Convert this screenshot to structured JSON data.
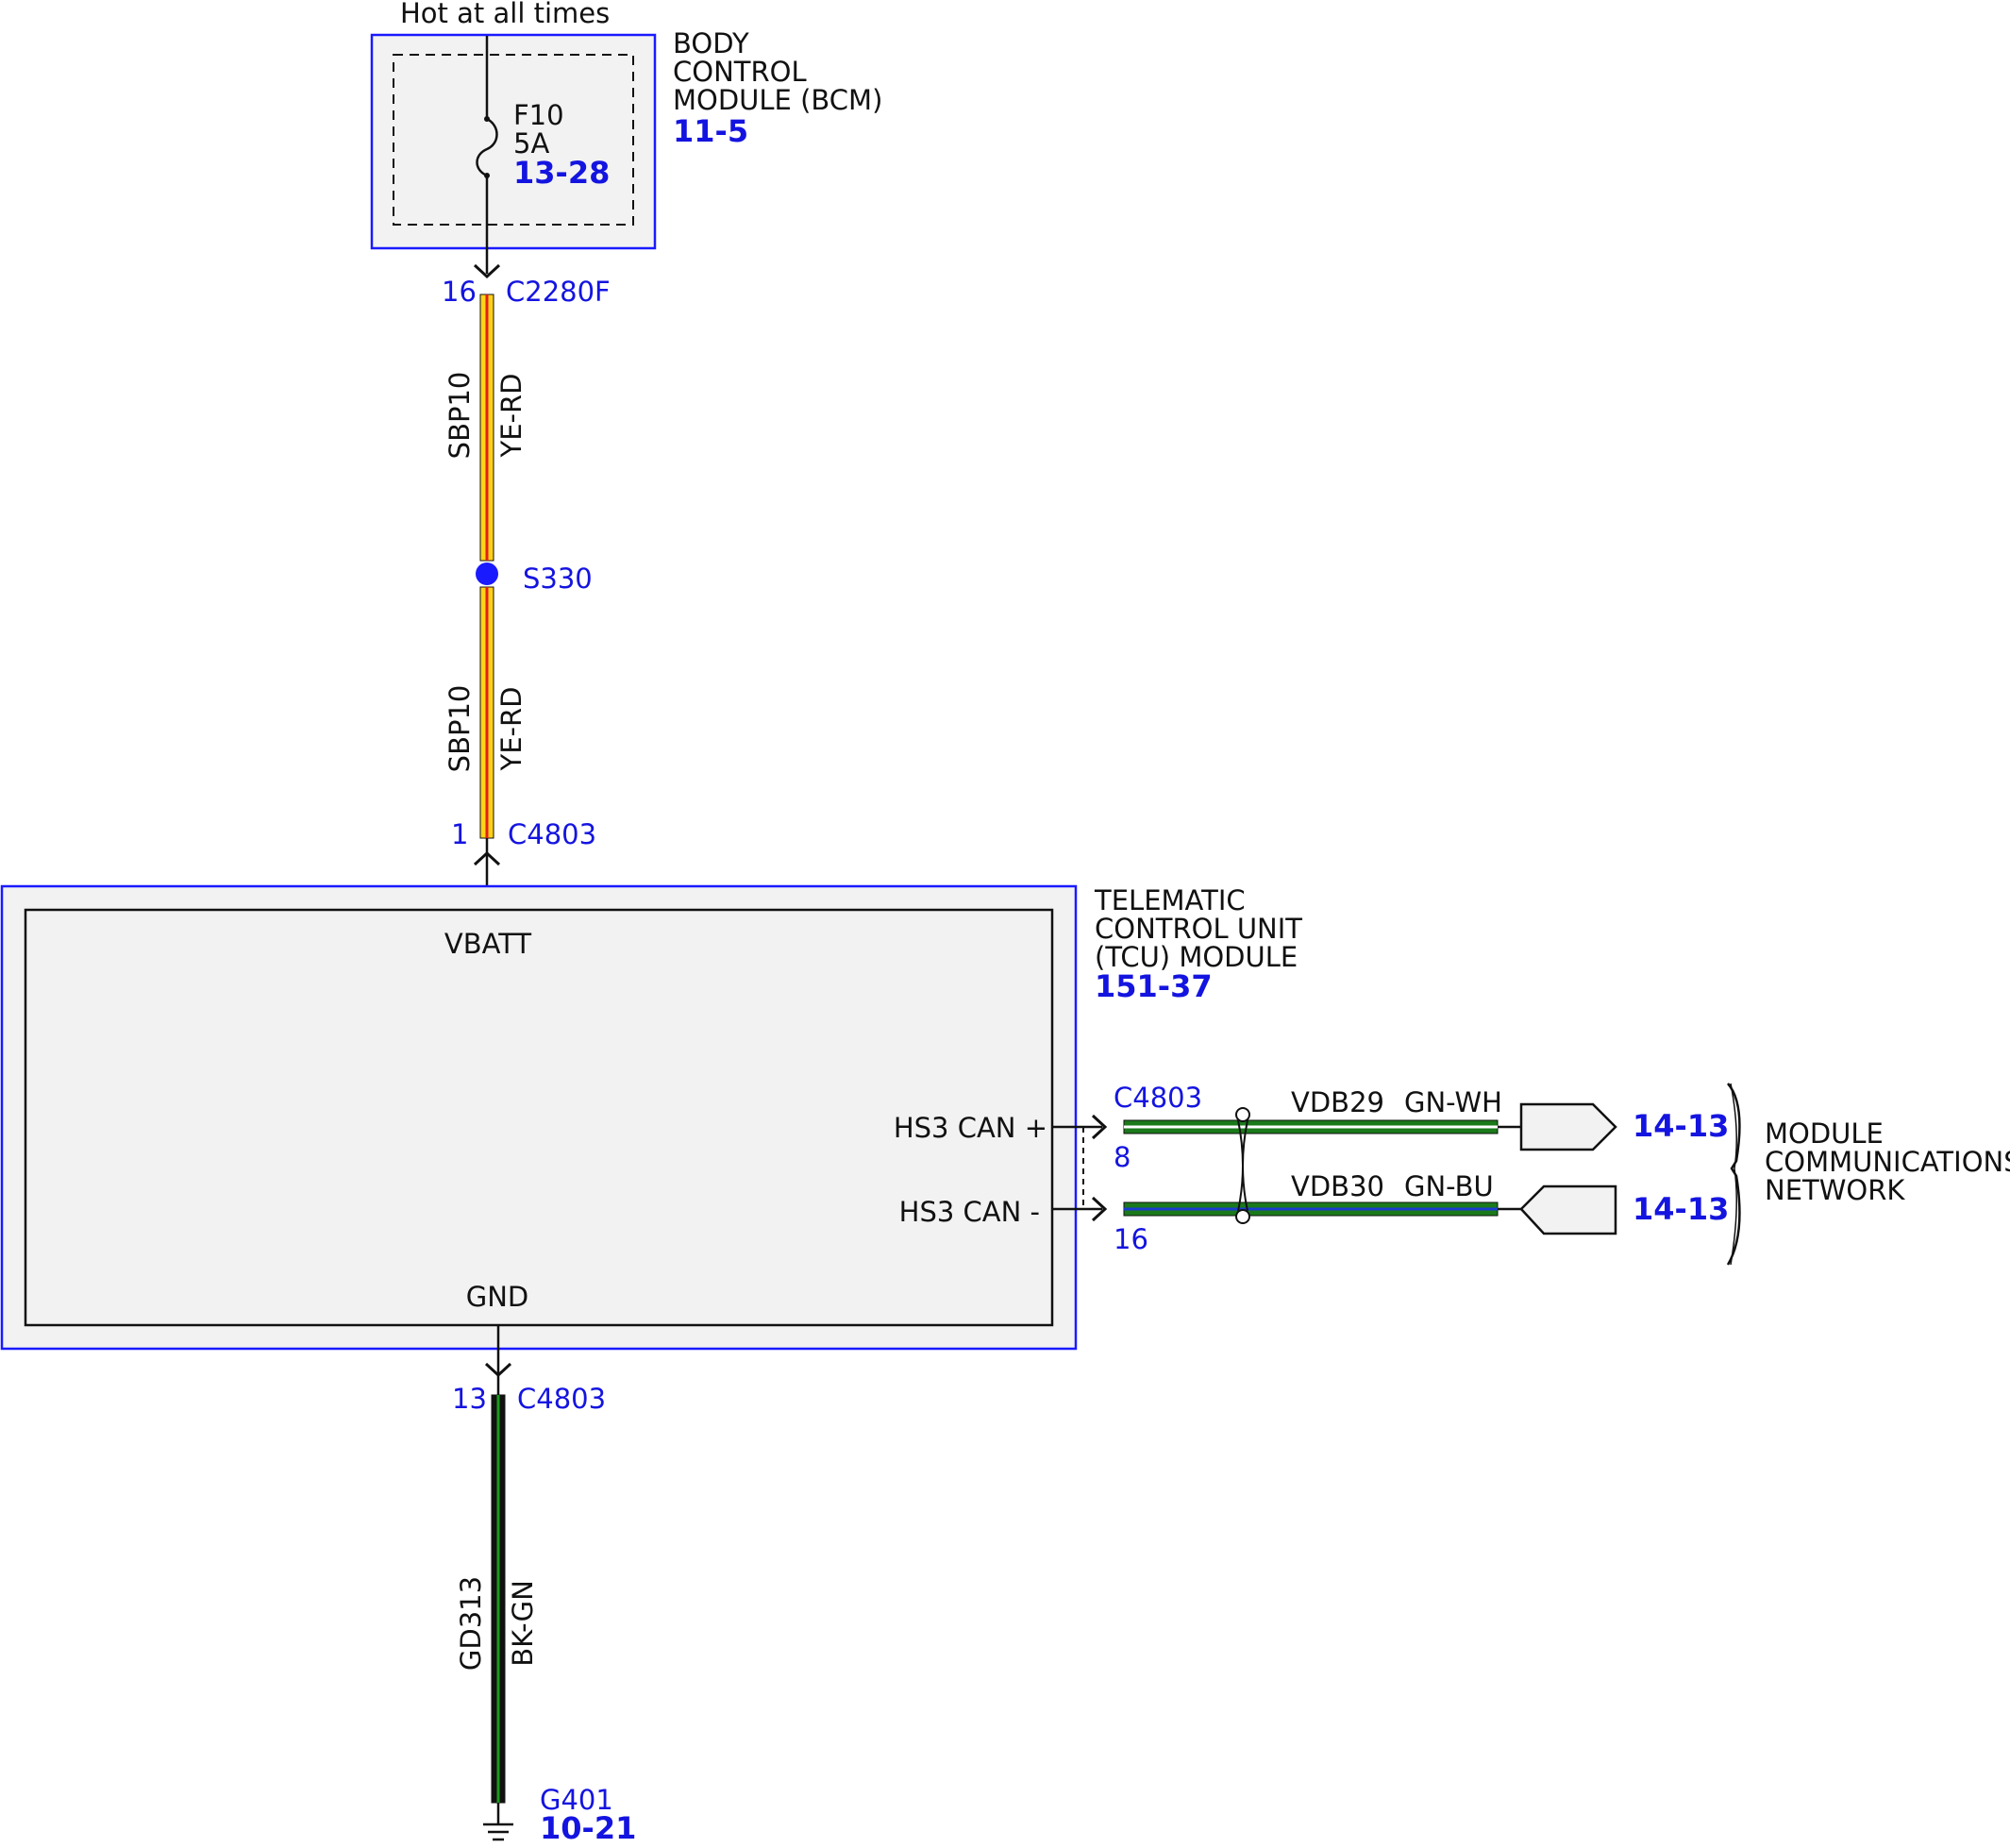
{
  "colors": {
    "module_border": "#1a1aff",
    "module_fill": "#f2f2f2",
    "label_blue": "#1414e0",
    "wire_yellow": "#ffd21a",
    "wire_red": "#e0201a",
    "wire_green": "#1a7a1a",
    "wire_white": "#ffffff",
    "wire_blue": "#1a3ad0",
    "wire_black": "#111111"
  },
  "power_label": "Hot at all times",
  "bcm": {
    "name_lines": [
      "BODY",
      "CONTROL",
      "MODULE (BCM)"
    ],
    "ref": "11-5",
    "fuse": {
      "name": "F10",
      "rating": "5A",
      "ref": "13-28"
    }
  },
  "connector_bcm": {
    "pin": "16",
    "id": "C2280F"
  },
  "wire_sbp10_upper": {
    "circuit": "SBP10",
    "color_code": "YE-RD"
  },
  "splice": {
    "id": "S330"
  },
  "wire_sbp10_lower": {
    "circuit": "SBP10",
    "color_code": "YE-RD"
  },
  "connector_tcu_power": {
    "pin": "1",
    "id": "C4803"
  },
  "tcu": {
    "name_lines": [
      "TELEMATIC",
      "CONTROL UNIT",
      "(TCU) MODULE"
    ],
    "ref": "151-37",
    "pin_vbatt": "VBATT",
    "pin_gnd": "GND",
    "pin_can_plus": "HS3 CAN +",
    "pin_can_minus": "HS3 CAN -"
  },
  "can_connector": {
    "id": "C4803",
    "pin_plus": "8",
    "pin_minus": "16"
  },
  "wire_vdb29": {
    "circuit": "VDB29",
    "color_code": "GN-WH",
    "ref": "14-13"
  },
  "wire_vdb30": {
    "circuit": "VDB30",
    "color_code": "GN-BU",
    "ref": "14-13"
  },
  "network": {
    "name_lines": [
      "MODULE",
      "COMMUNICATIONS",
      "NETWORK"
    ]
  },
  "connector_tcu_gnd": {
    "pin": "13",
    "id": "C4803"
  },
  "wire_gd313": {
    "circuit": "GD313",
    "color_code": "BK-GN"
  },
  "ground": {
    "id": "G401",
    "ref": "10-21"
  }
}
